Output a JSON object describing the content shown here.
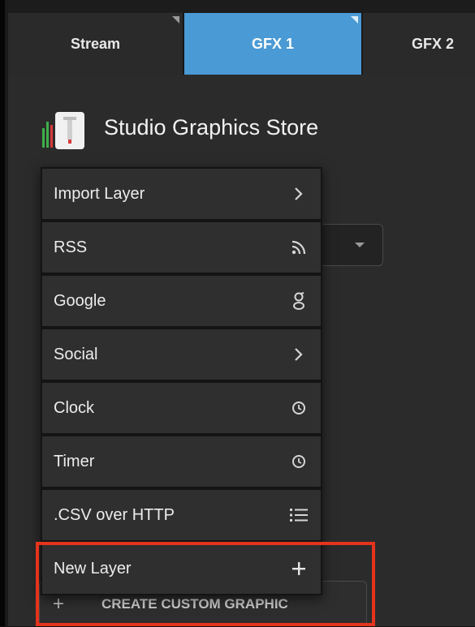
{
  "tabs": [
    {
      "label": "Stream",
      "active": false
    },
    {
      "label": "GFX 1",
      "active": true
    },
    {
      "label": "GFX 2",
      "active": false
    }
  ],
  "store": {
    "title": "Studio Graphics Store",
    "logo_icon": "studio-graphics-store-icon"
  },
  "menu": {
    "items": [
      {
        "label": "Import Layer",
        "icon": "chevron-right-icon"
      },
      {
        "label": "RSS",
        "icon": "rss-icon"
      },
      {
        "label": "Google",
        "icon": "google-icon"
      },
      {
        "label": "Social",
        "icon": "chevron-right-icon"
      },
      {
        "label": "Clock",
        "icon": "clock-icon"
      },
      {
        "label": "Timer",
        "icon": "clock-icon"
      },
      {
        "label": ".CSV over HTTP",
        "icon": "list-icon"
      },
      {
        "label": "New Layer",
        "icon": "plus-icon"
      }
    ]
  },
  "create_button": {
    "plus": "+",
    "label": "CREATE CUSTOM GRAPHIC"
  },
  "colors": {
    "accent_tab": "#4a9ad6",
    "highlight_border": "#e5331c"
  }
}
